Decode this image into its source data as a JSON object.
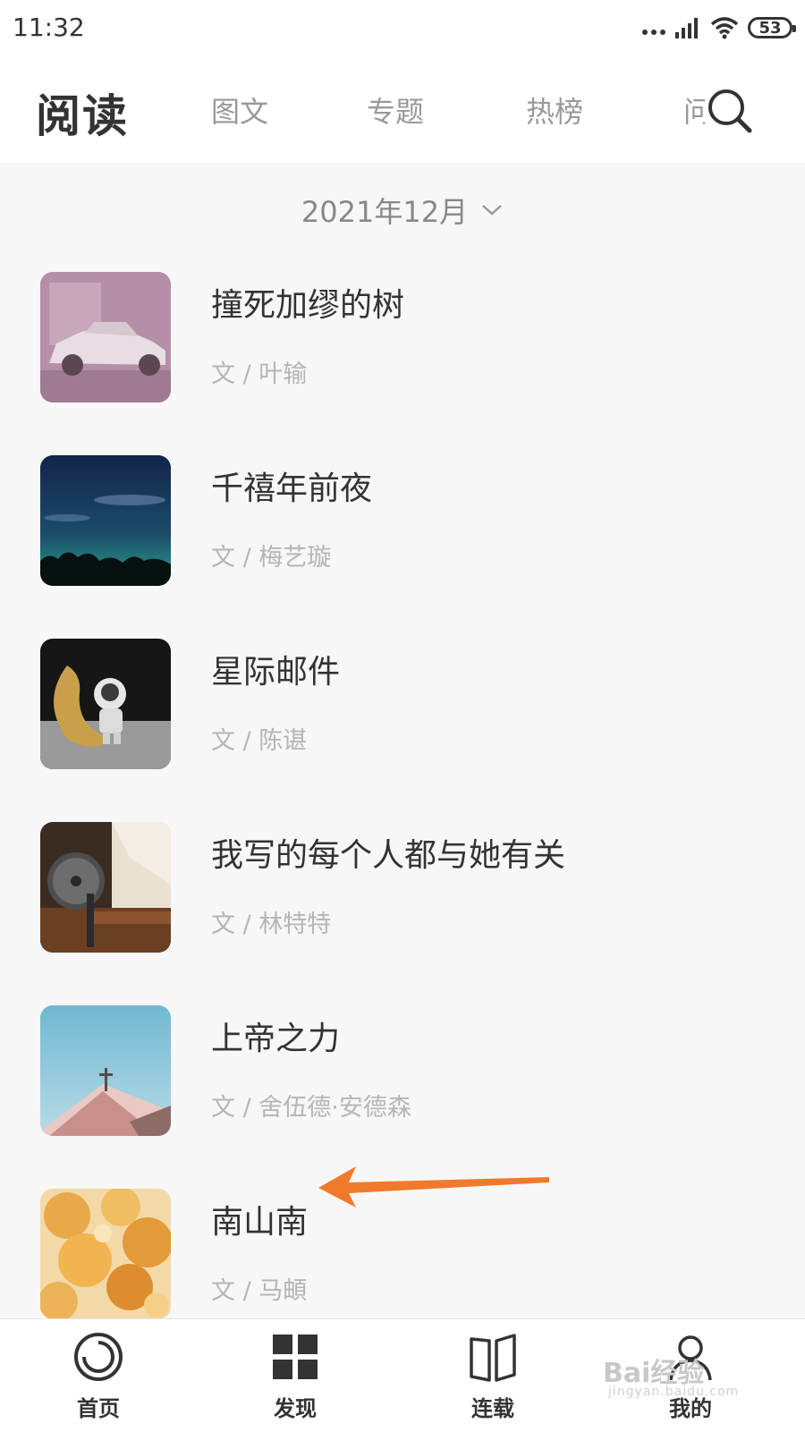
{
  "status_bar": {
    "time": "11:32",
    "battery": "53"
  },
  "header": {
    "title": "阅读",
    "tabs": [
      {
        "label": "图文"
      },
      {
        "label": "专题"
      },
      {
        "label": "热榜"
      },
      {
        "label": "问"
      }
    ]
  },
  "month_selector": {
    "label": "2021年12月"
  },
  "articles": [
    {
      "title": "撞死加缪的树",
      "author": "文 / 叶输"
    },
    {
      "title": "千禧年前夜",
      "author": "文 / 梅艺璇"
    },
    {
      "title": "星际邮件",
      "author": "文 / 陈谌"
    },
    {
      "title": "我写的每个人都与她有关",
      "author": "文 / 林特特"
    },
    {
      "title": "上帝之力",
      "author": "文 / 舍伍德·安德森"
    },
    {
      "title": "南山南",
      "author": "文 / 马頔"
    }
  ],
  "bottom_nav": {
    "items": [
      {
        "label": "首页",
        "icon": "home-circle-icon"
      },
      {
        "label": "发现",
        "icon": "grid-icon"
      },
      {
        "label": "连载",
        "icon": "book-icon"
      },
      {
        "label": "我的",
        "icon": "person-icon"
      }
    ]
  },
  "watermark": {
    "text": "Bai经验",
    "sub": "jingyan.baidu.com"
  },
  "colors": {
    "accent_arrow": "#f07a2c",
    "background": "#f7f7f7",
    "text_primary": "#333333",
    "text_secondary": "#b5b5b5"
  }
}
